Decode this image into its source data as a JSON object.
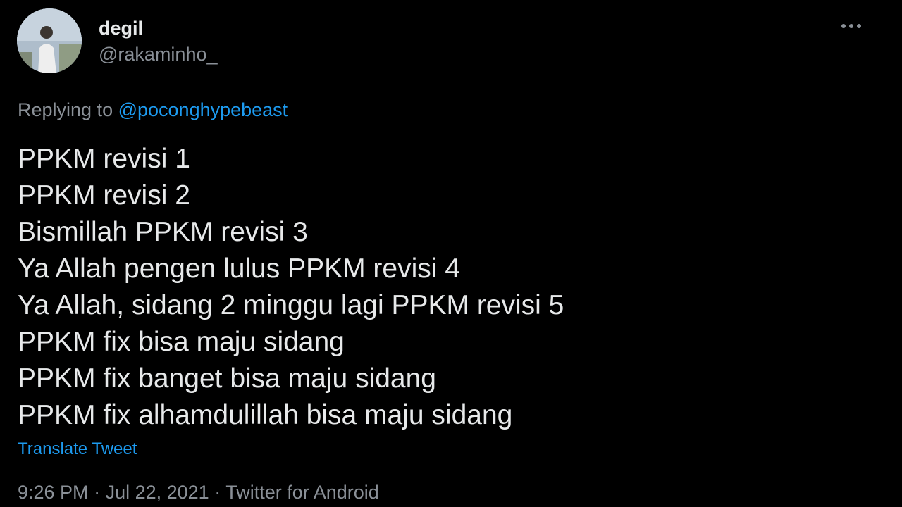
{
  "author": {
    "display_name": "degil",
    "handle": "@rakaminho_"
  },
  "reply": {
    "prefix": "Replying to ",
    "mention": "@poconghypebeast"
  },
  "tweet": {
    "lines": [
      "PPKM revisi 1",
      "PPKM revisi 2",
      "Bismillah PPKM revisi 3",
      "Ya Allah pengen lulus PPKM revisi 4",
      "Ya Allah, sidang 2 minggu lagi PPKM revisi 5",
      "PPKM fix bisa maju sidang",
      "PPKM fix banget bisa maju sidang",
      "PPKM fix alhamdulillah bisa maju sidang"
    ],
    "translate_label": "Translate Tweet"
  },
  "meta": {
    "time": "9:26 PM",
    "separator": " · ",
    "date": "Jul 22, 2021",
    "source": "Twitter for Android"
  },
  "icons": {
    "more": "more-horizontal-icon"
  },
  "colors": {
    "background": "#000000",
    "primary_text": "#e7e9ea",
    "secondary_text": "#8a9097",
    "link": "#1d9bf0"
  }
}
